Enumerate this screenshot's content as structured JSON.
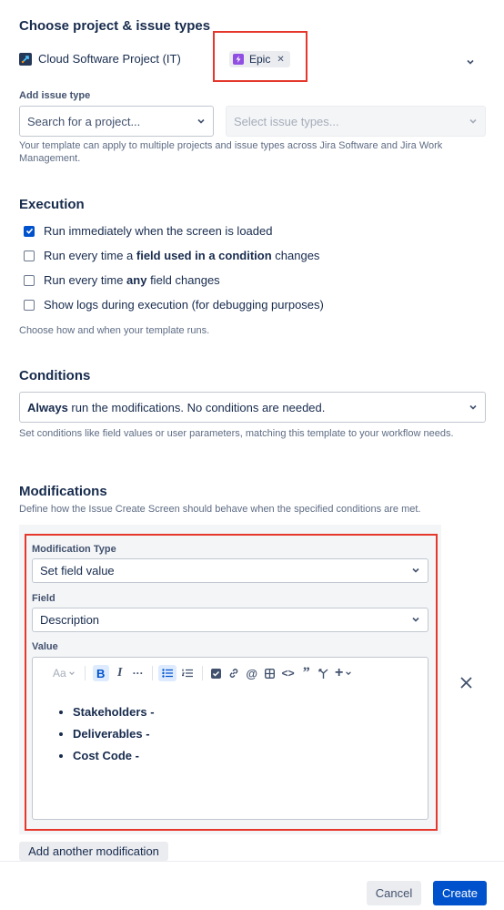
{
  "project_section": {
    "title": "Choose project & issue types",
    "project_name": "Cloud Software Project (IT)",
    "issue_type_chip": "Epic",
    "add_issue_type_label": "Add issue type",
    "search_project_placeholder": "Search for a project...",
    "select_issue_types_placeholder": "Select issue types...",
    "help_text": "Your template can apply to multiple projects and issue types across Jira Software and Jira Work Management."
  },
  "execution": {
    "title": "Execution",
    "options": [
      {
        "checked": true,
        "parts": [
          "Run immediately when the screen is loaded",
          "",
          ""
        ]
      },
      {
        "checked": false,
        "parts": [
          "Run every time a ",
          "field used in a condition",
          " changes"
        ]
      },
      {
        "checked": false,
        "parts": [
          "Run every time ",
          "any",
          " field changes"
        ]
      },
      {
        "checked": false,
        "parts": [
          "Show logs during execution (for debugging purposes)",
          "",
          ""
        ]
      }
    ],
    "help_text": "Choose how and when your template runs."
  },
  "conditions": {
    "title": "Conditions",
    "select_bold": "Always",
    "select_rest": " run the modifications. No conditions are needed.",
    "help_text": "Set conditions like field values or user parameters, matching this template to your workflow needs."
  },
  "modifications": {
    "title": "Modifications",
    "subtitle": "Define how the Issue Create Screen should behave when the specified conditions are met.",
    "modification_type_label": "Modification Type",
    "modification_type_value": "Set field value",
    "field_label": "Field",
    "field_value": "Description",
    "value_label": "Value",
    "text_style_label": "Aa",
    "bullets": [
      "Stakeholders -",
      "Deliverables -",
      "Cost Code -"
    ],
    "add_button": "Add another modification"
  },
  "footer": {
    "cancel": "Cancel",
    "create": "Create"
  },
  "colors": {
    "primary": "#0052cc",
    "highlight": "#e5372b",
    "epic": "#904ee2"
  }
}
